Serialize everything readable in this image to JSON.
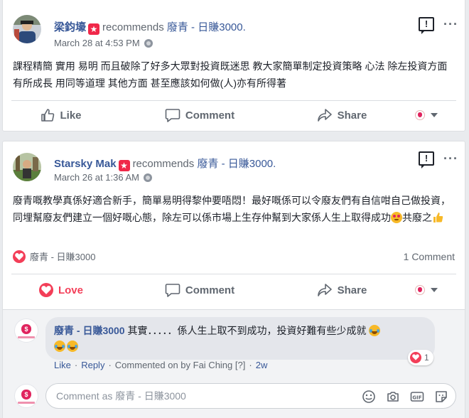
{
  "posts": [
    {
      "author": "梁鈞壕",
      "recommends_text": "recommends",
      "page_name": "廢青 - 日賺3000.",
      "timestamp": "March 28 at 4:53 PM",
      "visibility_icon": "globe-icon",
      "text": "課程精簡 實用 易明 而且破除了好多大眾對投資既迷思 教大家簡單制定投資策略 心法 除左投資方面有所成長 用同等道理 其他方面 甚至應該如何做(人)亦有所得著",
      "actions": {
        "like": "Like",
        "comment": "Comment",
        "share": "Share"
      }
    },
    {
      "author": "Starsky Mak",
      "recommends_text": "recommends",
      "page_name": "廢青 - 日賺3000.",
      "timestamp": "March 26 at 1:36 AM",
      "visibility_icon": "globe-icon",
      "text": "廢青嘅教學真係好適合新手，簡單易明得黎仲要唔悶！最好嘅係可以令廢友們有自信咁自己做投資，同埋幫廢友們建立一個好嘅心態，除左可以係市場上生存仲幫到大家係人生上取得成功",
      "text_tail": "共廢之",
      "reactions_name": "廢青 - 日賺3000",
      "comment_count": "1 Comment",
      "actions": {
        "like": "Love",
        "comment": "Comment",
        "share": "Share"
      },
      "comment": {
        "author": "廢青 - 日賺3000",
        "text": "其實．．．．．係人生上取不到成功，投資好難有些少成就",
        "reaction_count": "1",
        "like": "Like",
        "reply": "Reply",
        "commented_by": "Commented on by Fai Ching",
        "help": "[?]",
        "age": "2w"
      },
      "compose_placeholder": "Comment as 廢青 - 日賺3000"
    }
  ],
  "colors": {
    "link": "#385898",
    "love": "#f33e58",
    "muted": "#606770",
    "badge": "#f02849"
  }
}
